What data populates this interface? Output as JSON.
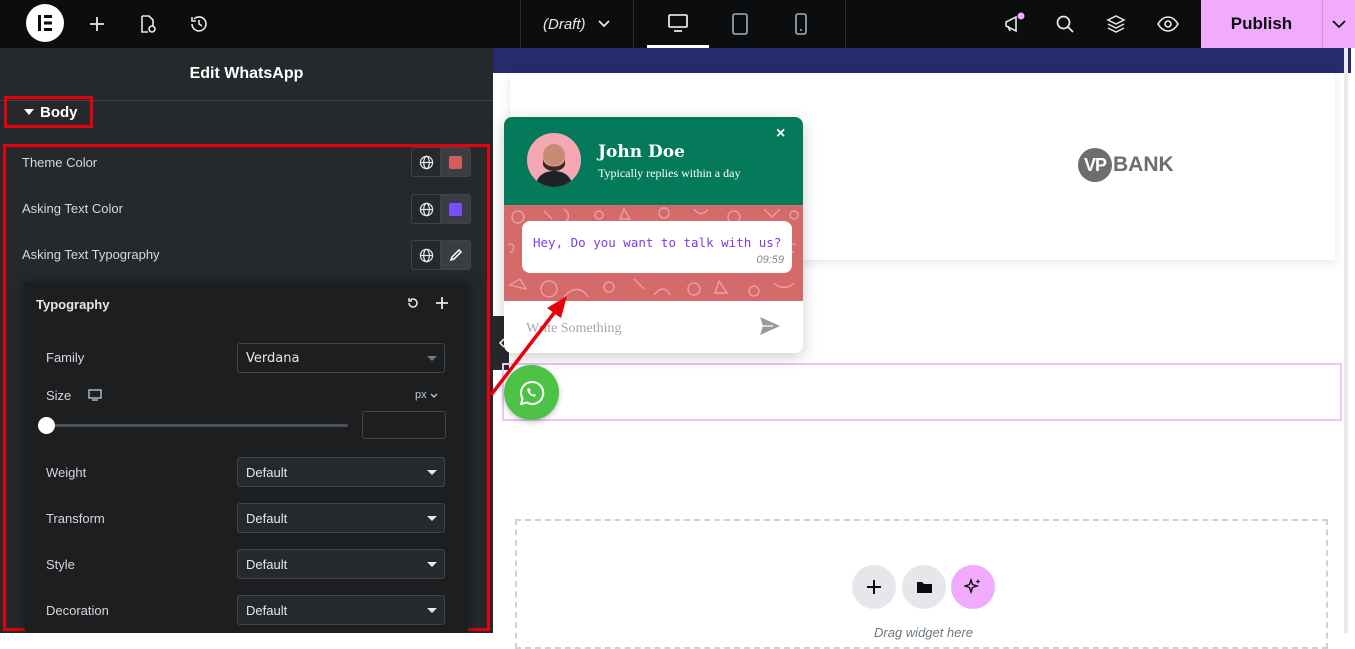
{
  "topbar": {
    "draft_label": "(Draft)",
    "publish_label": "Publish",
    "accent": "#f0abfc"
  },
  "panel": {
    "title": "Edit WhatsApp",
    "section_label": "Body",
    "controls": [
      {
        "label": "Theme Color",
        "swatch": "#d45d5d"
      },
      {
        "label": "Asking Text Color",
        "swatch": "#7c4dff"
      },
      {
        "label": "Asking Text Typography"
      }
    ],
    "typography": {
      "title": "Typography",
      "family_label": "Family",
      "family_value": "Verdana",
      "size_label": "Size",
      "size_unit": "px",
      "size_value": "",
      "weight_label": "Weight",
      "weight_value": "Default",
      "transform_label": "Transform",
      "transform_value": "Default",
      "style_label": "Style",
      "style_value": "Default",
      "decoration_label": "Decoration",
      "decoration_value": "Default"
    }
  },
  "canvas": {
    "logo_text": "BANK",
    "logo_badge": "VP",
    "drag_text": "Drag widget here"
  },
  "whatsapp": {
    "name": "John Doe",
    "subtitle": "Typically replies within a day",
    "close": "×",
    "message": "Hey, Do you want to talk with us?",
    "time": "09:59",
    "placeholder": "Write Something",
    "header_color": "#057a5b",
    "body_color": "#d46a6a",
    "fab_color": "#4dc247"
  }
}
